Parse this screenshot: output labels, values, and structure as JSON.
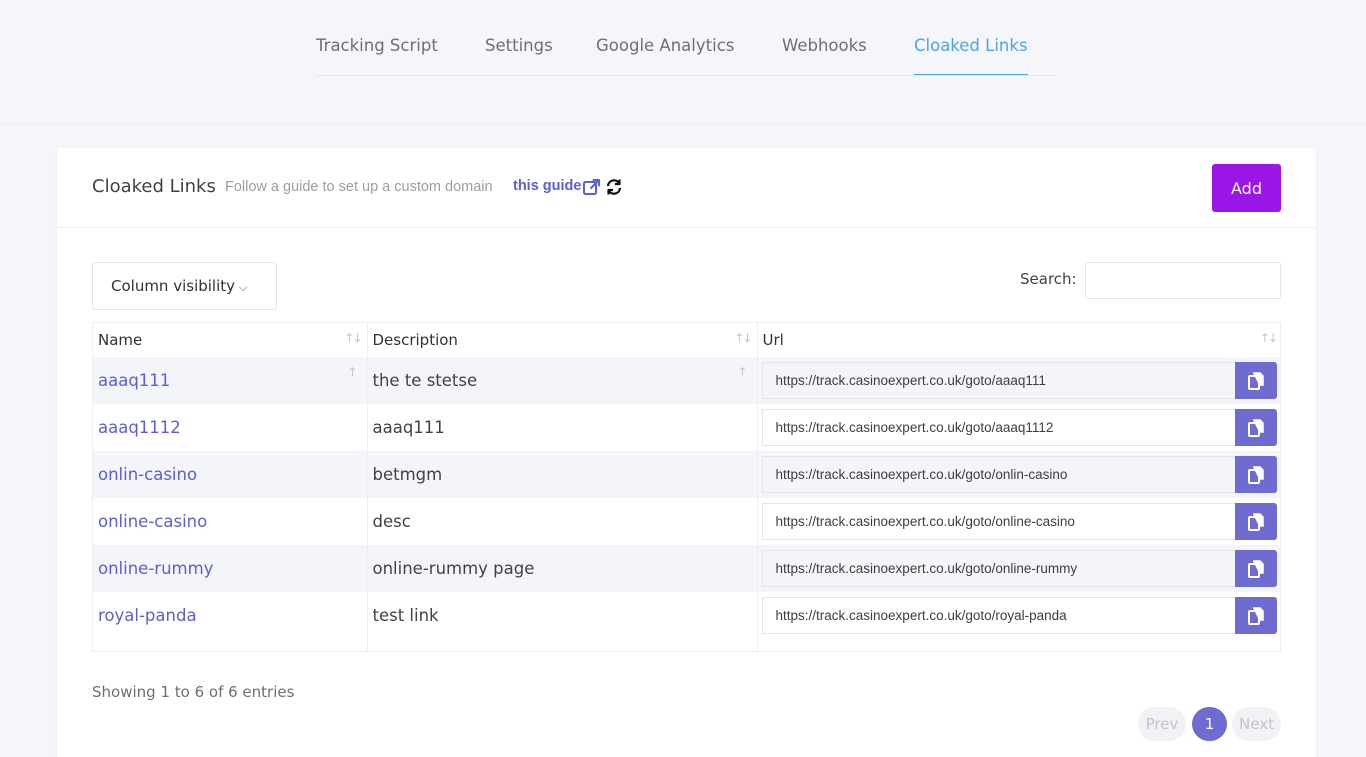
{
  "tabs": [
    {
      "label": "Tracking Script",
      "active": false
    },
    {
      "label": "Settings",
      "active": false
    },
    {
      "label": "Google Analytics",
      "active": false
    },
    {
      "label": "Webhooks",
      "active": false
    },
    {
      "label": "Cloaked Links",
      "active": true
    }
  ],
  "card": {
    "title": "Cloaked Links",
    "hint": "Follow a guide to set up a custom domain",
    "guide_link": "this guide",
    "add_label": "Add"
  },
  "toolbar": {
    "column_visibility_label": "Column visibility",
    "search_label": "Search:",
    "search_value": ""
  },
  "table": {
    "columns": [
      "Name",
      "Description",
      "Url"
    ],
    "rows": [
      {
        "name": "aaaq111",
        "description": "the te stetse",
        "url": "https://track.casinoexpert.co.uk/goto/aaaq111"
      },
      {
        "name": "aaaq1112",
        "description": "aaaq111",
        "url": "https://track.casinoexpert.co.uk/goto/aaaq1112"
      },
      {
        "name": "onlin-casino",
        "description": "betmgm",
        "url": "https://track.casinoexpert.co.uk/goto/onlin-casino"
      },
      {
        "name": "online-casino",
        "description": "desc",
        "url": "https://track.casinoexpert.co.uk/goto/online-casino"
      },
      {
        "name": "online-rummy",
        "description": "online-rummy page",
        "url": "https://track.casinoexpert.co.uk/goto/online-rummy"
      },
      {
        "name": "royal-panda",
        "description": "test link",
        "url": "https://track.casinoexpert.co.uk/goto/royal-panda"
      }
    ]
  },
  "footer": {
    "info": "Showing 1 to 6 of 6 entries",
    "prev_label": "Prev",
    "current_page": "1",
    "next_label": "Next"
  },
  "colors": {
    "accent": "#4ea4e8",
    "add_button": "#9b17e8",
    "link": "#5a5fd6",
    "copy_button": "#6f6bd0"
  },
  "icons": {
    "external": "external-link-icon",
    "refresh": "refresh-icon",
    "copy": "copy-icon",
    "chevron": "chevron-down-icon",
    "sort": "sort-icon"
  }
}
